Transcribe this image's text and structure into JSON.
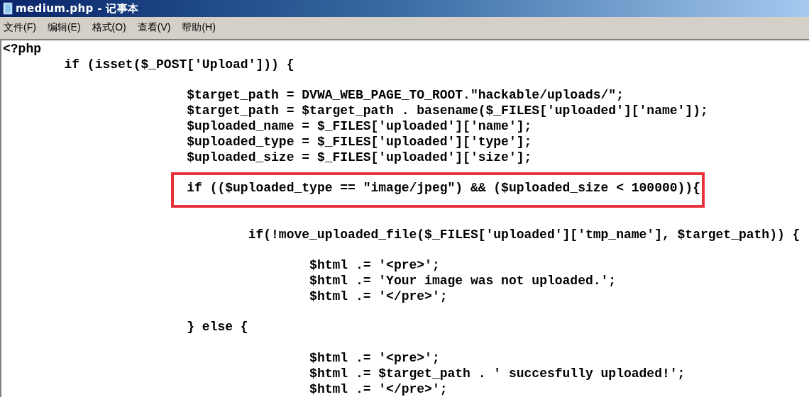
{
  "window": {
    "title": "medium.php - 记事本"
  },
  "menu": [
    {
      "label": "文件(F)"
    },
    {
      "label": "编辑(E)"
    },
    {
      "label": "格式(O)"
    },
    {
      "label": "查看(V)"
    },
    {
      "label": "帮助(H)"
    }
  ],
  "lines": [
    {
      "kind": "code",
      "text": "<?php",
      "highlighted": false
    },
    {
      "kind": "code",
      "text": "\tif (isset($_POST['Upload'])) {",
      "highlighted": false
    },
    {
      "kind": "blank"
    },
    {
      "kind": "code",
      "text": "\t\t\t$target_path = DVWA_WEB_PAGE_TO_ROOT.\"hackable/uploads/\";",
      "highlighted": false
    },
    {
      "kind": "code",
      "text": "\t\t\t$target_path = $target_path . basename($_FILES['uploaded']['name']);",
      "highlighted": false
    },
    {
      "kind": "code",
      "text": "\t\t\t$uploaded_name = $_FILES['uploaded']['name'];",
      "highlighted": false
    },
    {
      "kind": "code",
      "text": "\t\t\t$uploaded_type = $_FILES['uploaded']['type'];",
      "highlighted": false
    },
    {
      "kind": "code",
      "text": "\t\t\t$uploaded_size = $_FILES['uploaded']['size'];",
      "highlighted": false
    },
    {
      "kind": "blank"
    },
    {
      "kind": "code",
      "text": "\t\t\tif (($uploaded_type == \"image/jpeg\") && ($uploaded_size < 100000)){",
      "highlighted": true
    },
    {
      "kind": "blank"
    },
    {
      "kind": "blank"
    },
    {
      "kind": "code",
      "text": "\t\t\t\tif(!move_uploaded_file($_FILES['uploaded']['tmp_name'], $target_path)) {",
      "highlighted": false
    },
    {
      "kind": "blank"
    },
    {
      "kind": "code",
      "text": "\t\t\t\t\t$html .= '<pre>';",
      "highlighted": false
    },
    {
      "kind": "code",
      "text": "\t\t\t\t\t$html .= 'Your image was not uploaded.';",
      "highlighted": false
    },
    {
      "kind": "code",
      "text": "\t\t\t\t\t$html .= '</pre>';",
      "highlighted": false
    },
    {
      "kind": "blank"
    },
    {
      "kind": "code",
      "text": "\t\t\t} else {",
      "highlighted": false
    },
    {
      "kind": "blank"
    },
    {
      "kind": "code",
      "text": "\t\t\t\t\t$html .= '<pre>';",
      "highlighted": false
    },
    {
      "kind": "code",
      "text": "\t\t\t\t\t$html .= $target_path . ' succesfully uploaded!';",
      "highlighted": false
    },
    {
      "kind": "code",
      "text": "\t\t\t\t\t$html .= '</pre>';",
      "highlighted": false
    }
  ]
}
